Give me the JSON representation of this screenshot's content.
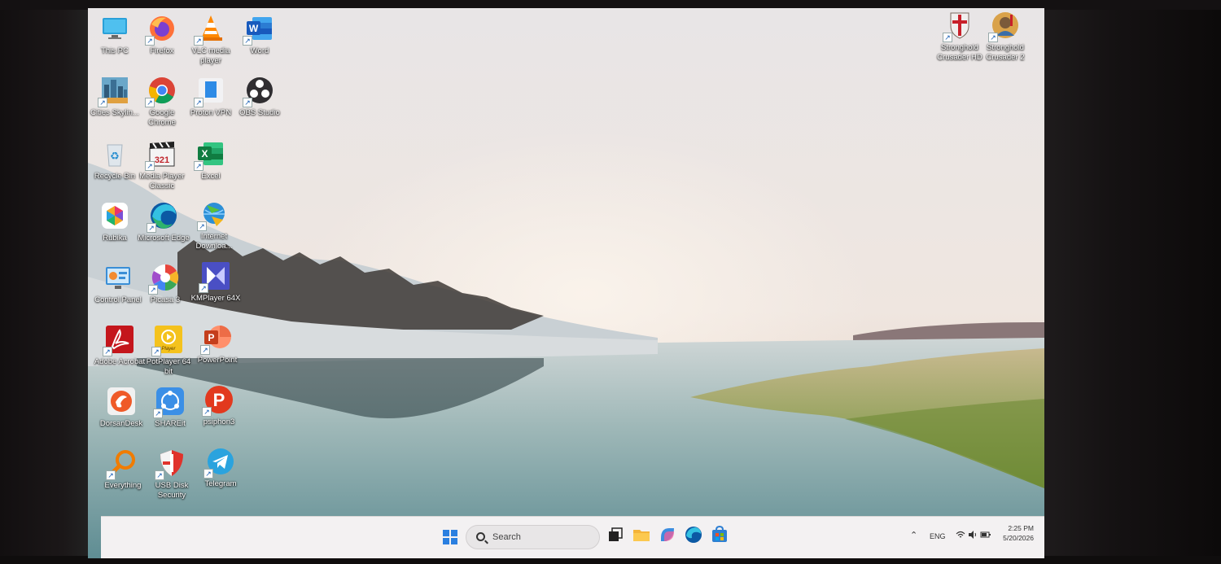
{
  "desktop": {
    "icons": [
      {
        "label": "This PC",
        "icon": "monitor-icon"
      },
      {
        "label": "Firefox",
        "icon": "firefox-icon"
      },
      {
        "label": "VLC media player",
        "icon": "vlc-cone-icon"
      },
      {
        "label": "Word",
        "icon": "word-icon"
      },
      {
        "label": "Cities Skylin...",
        "icon": "cities-skylines-icon"
      },
      {
        "label": "Google Chrome",
        "icon": "chrome-icon"
      },
      {
        "label": "Proton VPN",
        "icon": "proton-vpn-icon"
      },
      {
        "label": "OBS Studio",
        "icon": "obs-icon"
      },
      {
        "label": "Recycle Bin",
        "icon": "recycle-bin-icon"
      },
      {
        "label": "Media Player Classic",
        "icon": "clapperboard-icon"
      },
      {
        "label": "Excel",
        "icon": "excel-icon"
      },
      {
        "label": "Rubika",
        "icon": "rubika-icon"
      },
      {
        "label": "Microsoft Edge",
        "icon": "edge-icon"
      },
      {
        "label": "Internet Downloa...",
        "icon": "idm-globe-icon"
      },
      {
        "label": "Control Panel",
        "icon": "control-panel-icon"
      },
      {
        "label": "Picasa 3",
        "icon": "picasa-icon"
      },
      {
        "label": "KMPlayer 64X",
        "icon": "kmplayer-icon"
      },
      {
        "label": "Adobe Acrobat",
        "icon": "acrobat-icon"
      },
      {
        "label": "PotPlayer 64 bit",
        "icon": "potplayer-icon"
      },
      {
        "label": "PowerPoint",
        "icon": "powerpoint-icon"
      },
      {
        "label": "DorsanDesk",
        "icon": "dorsandesk-icon"
      },
      {
        "label": "SHAREit",
        "icon": "shareit-icon"
      },
      {
        "label": "psiphon3",
        "icon": "psiphon-icon"
      },
      {
        "label": "Everything",
        "icon": "everything-search-icon"
      },
      {
        "label": "USB Disk Security",
        "icon": "shield-icon"
      },
      {
        "label": "Telegram",
        "icon": "telegram-icon"
      },
      {
        "label": "Stronghold Crusader HD",
        "icon": "crusader-shield-icon"
      },
      {
        "label": "Stronghold Crusader 2",
        "icon": "crusader-knight-icon"
      }
    ],
    "potplayer_badge": "Player"
  },
  "taskbar": {
    "search_placeholder": "Search",
    "pinned": [
      "task-view-icon",
      "file-explorer-icon",
      "copilot-icon",
      "edge-icon",
      "store-icon"
    ],
    "tray": {
      "language": "ENG",
      "time": "2:25 PM",
      "date": "5/20/2026"
    }
  },
  "colors": {
    "taskbar_bg": "#f3f1f2",
    "windows_blue": "#2a7fe0"
  }
}
